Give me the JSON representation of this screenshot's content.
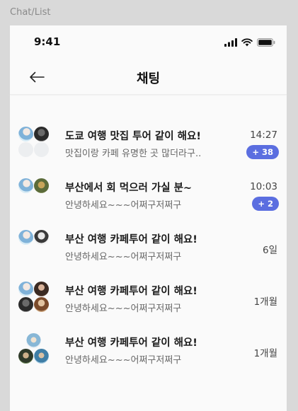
{
  "frame_label": "Chat/List",
  "status": {
    "time": "9:41"
  },
  "header": {
    "title": "채팅"
  },
  "chats": [
    {
      "title": "도쿄 여행 맛집 투어 같이 해요!",
      "preview": "맛집이랑 카페 유명한 곳 많더라구..",
      "time": "14:27",
      "badge": "+ 38"
    },
    {
      "title": "부산에서 회 먹으러 가실 분~",
      "preview": "안녕하세요~~~어쩌구저쩌구",
      "time": "10:03",
      "badge": "+ 2"
    },
    {
      "title": "부산 여행 카페투어 같이 해요!",
      "preview": "안녕하세요~~~어쩌구저쩌구",
      "time": "6일"
    },
    {
      "title": "부산 여행 카페투어 같이 해요!",
      "preview": "안녕하세요~~~어쩌구저쩌구",
      "time": "1개월"
    },
    {
      "title": "부산 여행 카페투어 같이 해요!",
      "preview": "안녕하세요~~~어쩌구저쩌구",
      "time": "1개월"
    }
  ],
  "colors": {
    "accent": "#5b6ee0",
    "background": "#fafafa",
    "canvas": "#d9d9d9"
  },
  "icons": {
    "back": "arrow-left-icon",
    "signal": "cellular-signal-icon",
    "wifi": "wifi-icon",
    "battery": "battery-icon"
  }
}
